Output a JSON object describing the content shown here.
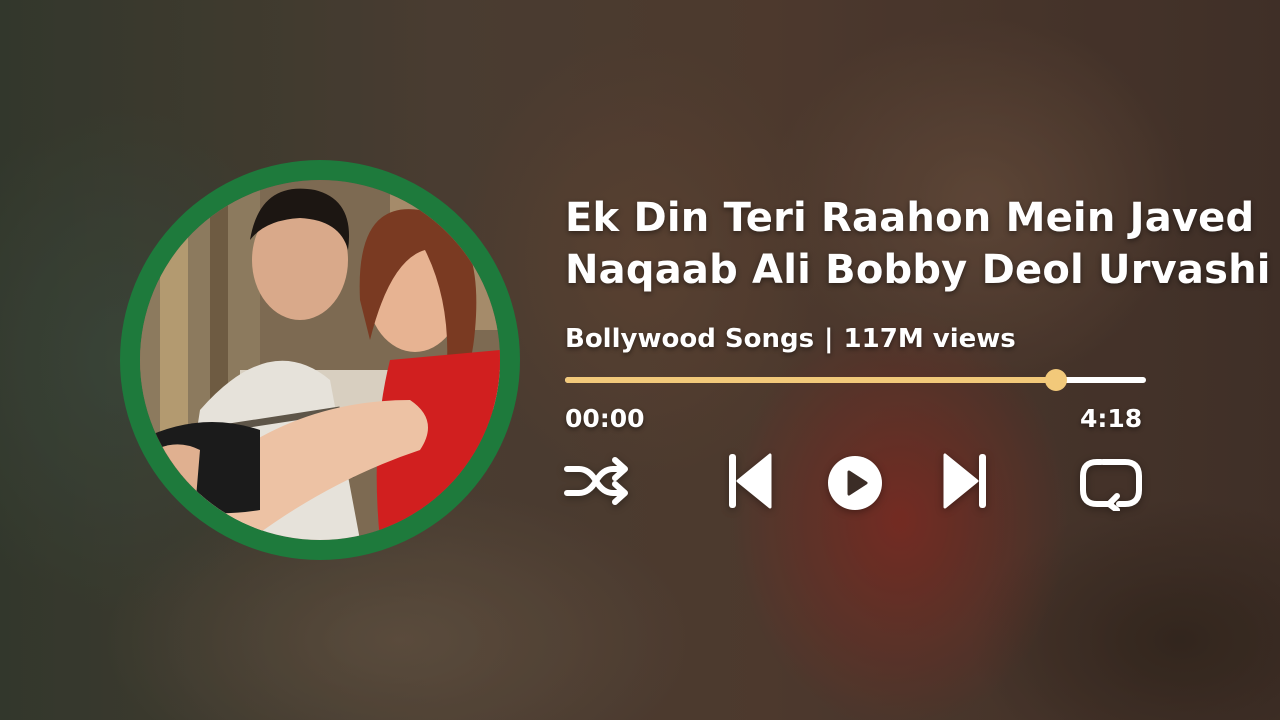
{
  "song": {
    "title_line1": "Ek Din Teri Raahon Mein Javed",
    "title_line2": "Naqaab Ali Bobby Deol Urvashi"
  },
  "meta": {
    "channel": "Bollywood Songs",
    "separator": "|",
    "views": "117M views"
  },
  "playback": {
    "elapsed": "00:00",
    "total": "4:18",
    "progress_fraction": 0.845
  },
  "controls": {
    "shuffle_icon": "shuffle-icon",
    "previous_icon": "skip-previous-icon",
    "play_icon": "play-icon",
    "next_icon": "skip-next-icon",
    "repeat_icon": "repeat-icon"
  },
  "colors": {
    "accent": "#f2c97a",
    "art_ring": "#1e7a3c",
    "text": "#ffffff"
  }
}
